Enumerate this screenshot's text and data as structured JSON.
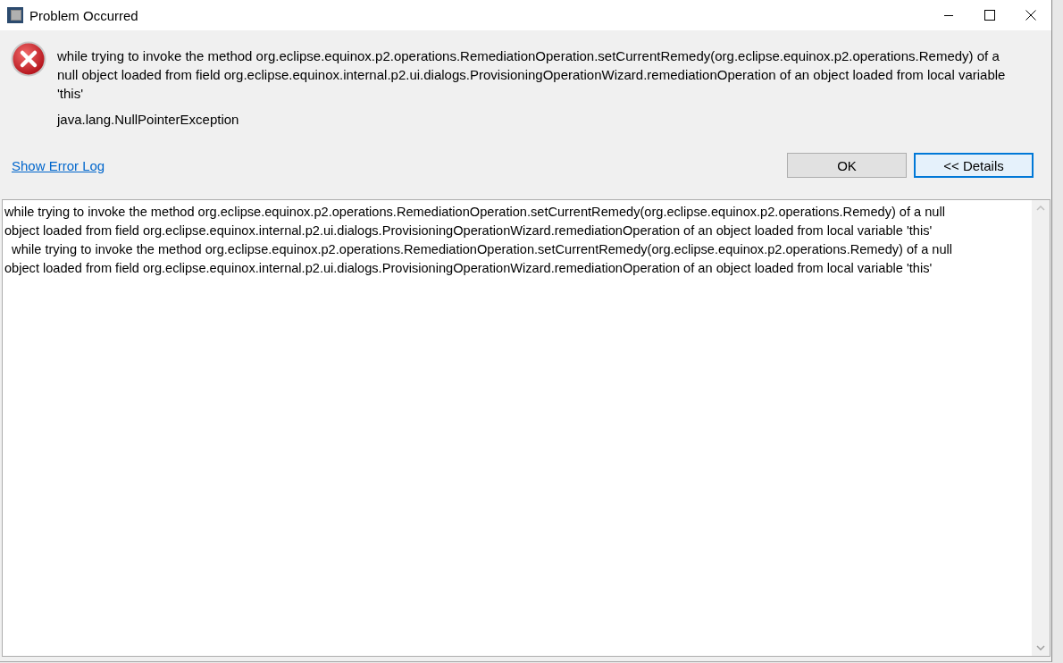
{
  "window": {
    "title": "Problem Occurred"
  },
  "message": "while trying to invoke the method org.eclipse.equinox.p2.operations.RemediationOperation.setCurrentRemedy(org.eclipse.equinox.p2.operations.Remedy) of a null object loaded from field org.eclipse.equinox.internal.p2.ui.dialogs.ProvisioningOperationWizard.remediationOperation of an object loaded from local variable 'this'",
  "exception": "java.lang.NullPointerException",
  "link": "Show Error Log",
  "buttons": [
    {
      "label": "OK",
      "focused": false
    },
    {
      "label": "<< Details",
      "focused": true
    }
  ],
  "details": {
    "lines": [
      "while trying to invoke the method org.eclipse.equinox.p2.operations.RemediationOperation.setCurrentRemedy(org.eclipse.equinox.p2.operations.Remedy) of a null",
      "object loaded from field org.eclipse.equinox.internal.p2.ui.dialogs.ProvisioningOperationWizard.remediationOperation of an object loaded from local variable 'this'",
      "  while trying to invoke the method org.eclipse.equinox.p2.operations.RemediationOperation.setCurrentRemedy(org.eclipse.equinox.p2.operations.Remedy) of a null",
      "object loaded from field org.eclipse.equinox.internal.p2.ui.dialogs.ProvisioningOperationWizard.remediationOperation of an object loaded from local variable 'this'"
    ]
  }
}
